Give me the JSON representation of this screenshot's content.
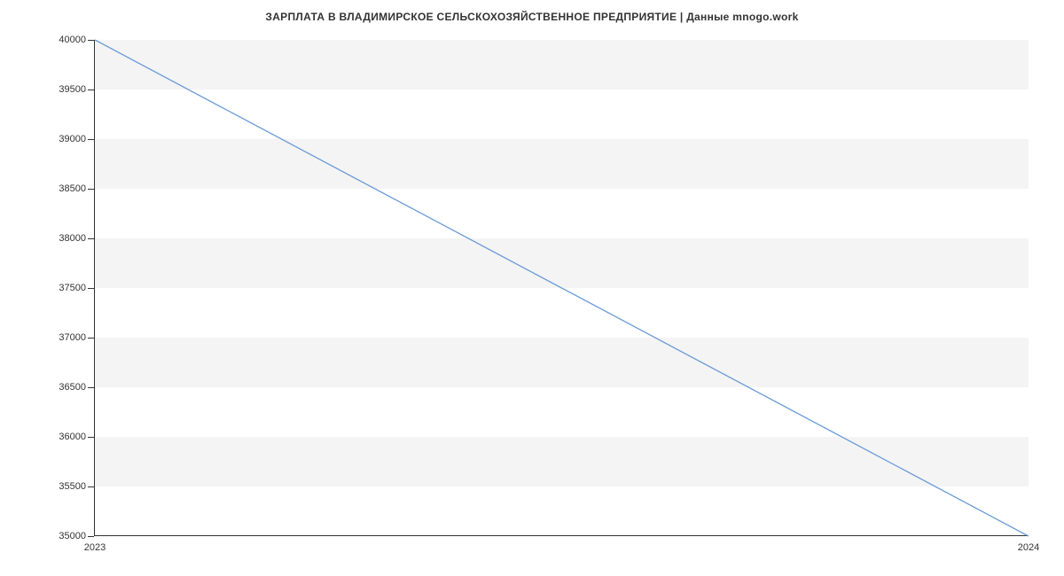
{
  "chart_data": {
    "type": "line",
    "title": "ЗАРПЛАТА В ВЛАДИМИРСКОЕ СЕЛЬСКОХОЗЯЙСТВЕННОЕ ПРЕДПРИЯТИЕ | Данные mnogo.work",
    "x": [
      2023,
      2024
    ],
    "values": [
      40000,
      35000
    ],
    "x_ticks": [
      2023,
      2024
    ],
    "y_ticks": [
      35000,
      35500,
      36000,
      36500,
      37000,
      37500,
      38000,
      38500,
      39000,
      39500,
      40000
    ],
    "ylim": [
      35000,
      40000
    ],
    "xlim": [
      2023,
      2024
    ],
    "xlabel": "",
    "ylabel": ""
  }
}
